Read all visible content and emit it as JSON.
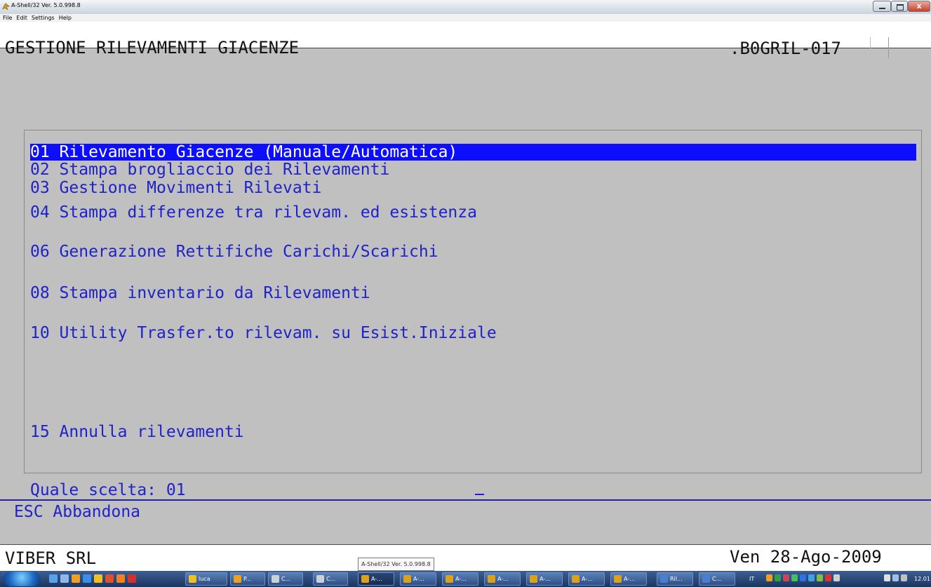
{
  "window": {
    "title": "A-Shell/32 Ver. 5.0.998.8",
    "close_glyph": "x"
  },
  "menubar": {
    "items": [
      "File",
      "Edit",
      "Settings",
      "Help"
    ]
  },
  "header": {
    "title": "GESTIONE RILEVAMENTI GIACENZE",
    "program_code": ".B0GRIL-017"
  },
  "menu": {
    "options": [
      "01 Rilevamento Giacenze (Manuale/Automatica)",
      "02 Stampa brogliaccio dei Rilevamenti",
      "03 Gestione Movimenti Rilevati",
      "04 Stampa differenze tra rilevam. ed esistenza",
      "06 Generazione Rettifiche Carichi/Scarichi",
      "08 Stampa inventario da Rilevamenti",
      "10 Utility Trasfer.to rilevam. su Esist.Iniziale",
      "15 Annulla rilevamenti"
    ],
    "selected_index": 0
  },
  "prompt": {
    "text": "Quale scelta: 01",
    "esc_hint": "ESC Abbandona"
  },
  "status": {
    "company": "VIBER SRL",
    "date": "Ven 28-Ago-2009",
    "tooltip": "A-Shell/32 Ver. 5.0.998.8"
  },
  "taskbar": {
    "tasks": [
      "luca",
      "P...",
      "C...",
      "C...",
      "A-...",
      "A-...",
      "A-...",
      "A-...",
      "A-...",
      "A-...",
      "A-...",
      "Ril...",
      "C..."
    ],
    "language": "IT",
    "clock": "12.01"
  },
  "colors": {
    "screen_bg": "#c0c0c0",
    "menu_text": "#1f22c9",
    "selection_bg": "#0d0dff",
    "selection_text": "#ffffff"
  }
}
